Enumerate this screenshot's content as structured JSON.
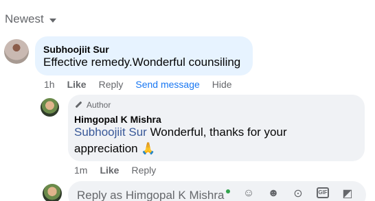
{
  "sort": {
    "label": "Newest"
  },
  "comment1": {
    "author": "Subhoojiit Sur",
    "text": "Effective remedy.Wonderful counsiling",
    "time": "1h",
    "like": "Like",
    "reply": "Reply",
    "send_message": "Send message",
    "hide": "Hide"
  },
  "comment2": {
    "badge": "Author",
    "author": "Himgopal K Mishra",
    "mention": "Subhoojiit Sur",
    "text": " Wonderful, thanks for your appreciation 🙏",
    "time": "1m",
    "like": "Like",
    "reply": "Reply"
  },
  "reply_box": {
    "placeholder": "Reply as Himgopal K Mishra",
    "icons": [
      "avatar-sticker-icon",
      "emoji-icon",
      "camera-icon",
      "gif-icon",
      "sticker-icon"
    ]
  },
  "colors": {
    "link": "#385898",
    "send_message": "#1877f2",
    "online": "#31a24c"
  }
}
